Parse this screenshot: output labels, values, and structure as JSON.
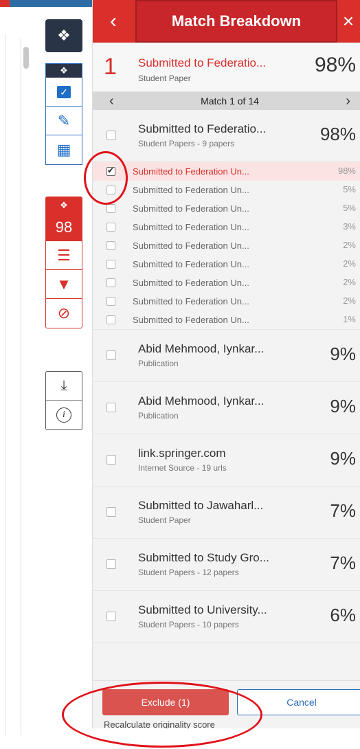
{
  "header": {
    "title": "Match Breakdown",
    "back_glyph": "‹",
    "close_glyph": "×"
  },
  "summary": {
    "rank": "1",
    "name": "Submitted to Federatio...",
    "type": "Student Paper",
    "percent": "98%"
  },
  "pager": {
    "label": "Match 1 of 14",
    "prev_glyph": "‹",
    "next_glyph": "›"
  },
  "group": {
    "name": "Submitted to Federatio...",
    "type": "Student Papers - 9 papers",
    "percent": "98%"
  },
  "sub_items": [
    {
      "name": "Submitted to Federation Un...",
      "percent": "98%",
      "checked": true
    },
    {
      "name": "Submitted to Federation Un...",
      "percent": "5%"
    },
    {
      "name": "Submitted to Federation Un...",
      "percent": "5%"
    },
    {
      "name": "Submitted to Federation Un...",
      "percent": "3%"
    },
    {
      "name": "Submitted to Federation Un...",
      "percent": "2%"
    },
    {
      "name": "Submitted to Federation Un...",
      "percent": "2%"
    },
    {
      "name": "Submitted to Federation Un...",
      "percent": "2%"
    },
    {
      "name": "Submitted to Federation Un...",
      "percent": "2%"
    },
    {
      "name": "Submitted to Federation Un...",
      "percent": "1%"
    }
  ],
  "sources": [
    {
      "name": "Abid Mehmood, Iynkar...",
      "type": "Publication",
      "percent": "9%"
    },
    {
      "name": "Abid Mehmood, Iynkar...",
      "type": "Publication",
      "percent": "9%"
    },
    {
      "name": "link.springer.com",
      "type": "Internet Source - 19 urls",
      "percent": "9%"
    },
    {
      "name": "Submitted to Jawaharl...",
      "type": "Student Paper",
      "percent": "7%"
    },
    {
      "name": "Submitted to Study Gro...",
      "type": "Student Papers - 12 papers",
      "percent": "7%"
    },
    {
      "name": "Submitted to University...",
      "type": "Student Papers - 10 papers",
      "percent": "6%"
    }
  ],
  "footer": {
    "exclude_label": "Exclude (1)",
    "cancel_label": "Cancel",
    "recalc_label": "Recalculate originality score"
  },
  "sidebar": {
    "score": "98",
    "icons": [
      "layers-icon",
      "checkbox-icon",
      "edit-icon",
      "grid-icon",
      "sort-icon",
      "filter-icon",
      "exclude-icon",
      "download-icon",
      "info-icon"
    ]
  },
  "colors": {
    "brand_red": "#d9302c",
    "brand_blue": "#2a6ebd",
    "dark_navy": "#2a3447",
    "annotation_red": "#e0131a"
  }
}
